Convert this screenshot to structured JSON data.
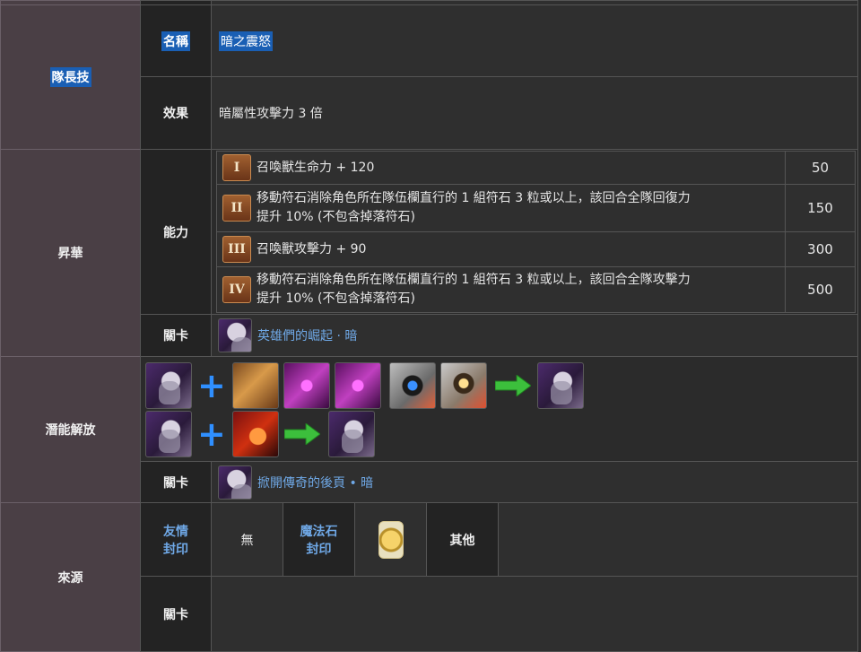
{
  "leader_skill": {
    "category": "隊長技",
    "name_label": "名稱",
    "name_value": "暗之震怒",
    "effect_label": "效果",
    "effect_value": "暗屬性攻擊力 3 倍"
  },
  "ascension": {
    "category": "昇華",
    "ability_label": "能力",
    "abilities": [
      {
        "numeral": "I",
        "text": "召喚獸生命力 + 120",
        "cost": "50"
      },
      {
        "numeral": "II",
        "text_line1": "移動符石消除角色所在隊伍欄直行的 1 組符石 3 粒或以上，該回合全隊回復力",
        "text_line2": "提升 10% (不包含掉落符石)",
        "cost": "150"
      },
      {
        "numeral": "III",
        "text": "召喚獸攻擊力 + 90",
        "cost": "300"
      },
      {
        "numeral": "IV",
        "text_line1": "移動符石消除角色所在隊伍欄直行的 1 組符石 3 粒或以上，該回合全隊攻擊力",
        "text_line2": "提升 10% (不包含掉落符石)",
        "cost": "500"
      }
    ],
    "stage_label": "關卡",
    "stage_link": "英雄們的崛起 · 暗"
  },
  "potential_release": {
    "category": "潛能解放",
    "stage_label": "關卡",
    "stage_link": "掀開傳奇的後頁 • 暗"
  },
  "source": {
    "category": "來源",
    "friend_seal": [
      "友情",
      "封印"
    ],
    "friend_seal_value": "無",
    "magic_stone_seal": [
      "魔法石",
      "封印"
    ],
    "other_label": "其他",
    "stage_label": "關卡"
  },
  "colors": {
    "accent": "#1a5fb4",
    "link": "#6fa8e6",
    "category_bg": "#4a3f45",
    "plus": "#2f8fff",
    "arrow": "#3cbf3c"
  }
}
